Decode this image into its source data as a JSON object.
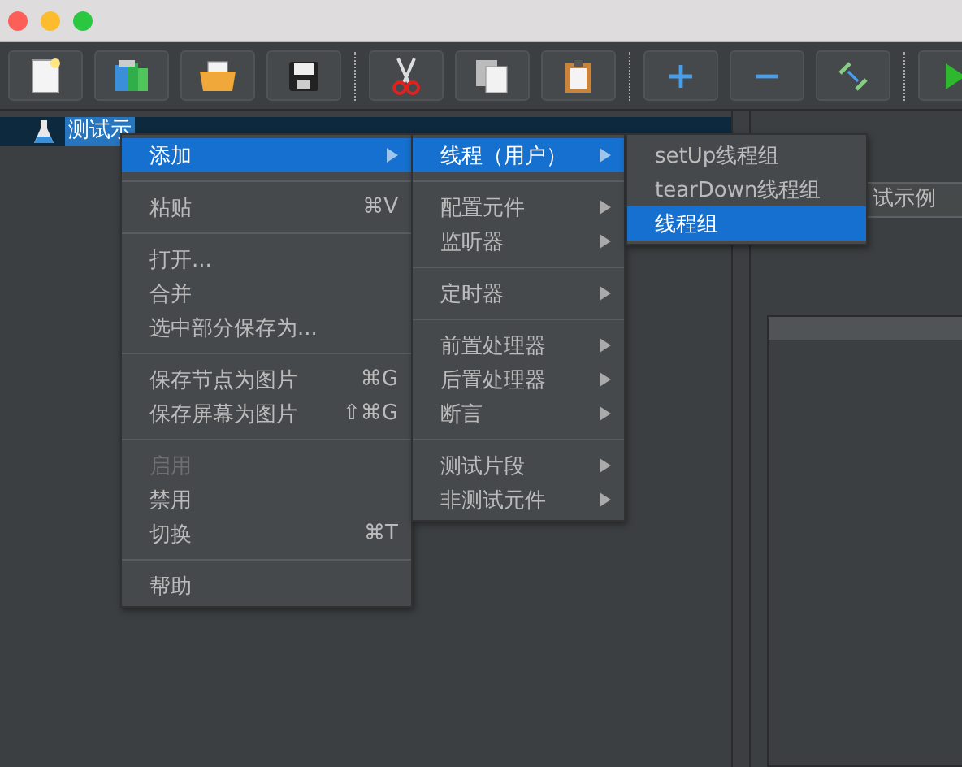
{
  "tree": {
    "items": [
      {
        "label": "测试示",
        "selected": true
      }
    ]
  },
  "name_field": {
    "value": "试示例"
  },
  "context_menu": {
    "items": [
      {
        "kind": "item",
        "label": "添加",
        "has_submenu": true,
        "selected": true,
        "disabled": false
      },
      {
        "kind": "separator"
      },
      {
        "kind": "item",
        "label": "粘贴",
        "shortcut": "⌘V",
        "has_submenu": false,
        "selected": false,
        "disabled": false
      },
      {
        "kind": "separator"
      },
      {
        "kind": "item",
        "label": "打开...",
        "has_submenu": false,
        "selected": false,
        "disabled": false
      },
      {
        "kind": "item",
        "label": "合并",
        "has_submenu": false,
        "selected": false,
        "disabled": false
      },
      {
        "kind": "item",
        "label": "选中部分保存为...",
        "has_submenu": false,
        "selected": false,
        "disabled": false
      },
      {
        "kind": "separator"
      },
      {
        "kind": "item",
        "label": "保存节点为图片",
        "shortcut": "⌘G",
        "has_submenu": false,
        "selected": false,
        "disabled": false
      },
      {
        "kind": "item",
        "label": "保存屏幕为图片",
        "shortcut": "⇧⌘G",
        "has_submenu": false,
        "selected": false,
        "disabled": false
      },
      {
        "kind": "separator"
      },
      {
        "kind": "item",
        "label": "启用",
        "has_submenu": false,
        "selected": false,
        "disabled": true
      },
      {
        "kind": "item",
        "label": "禁用",
        "has_submenu": false,
        "selected": false,
        "disabled": false
      },
      {
        "kind": "item",
        "label": "切换",
        "shortcut": "⌘T",
        "has_submenu": false,
        "selected": false,
        "disabled": false
      },
      {
        "kind": "separator"
      },
      {
        "kind": "item",
        "label": "帮助",
        "has_submenu": false,
        "selected": false,
        "disabled": false
      }
    ]
  },
  "add_submenu": {
    "items": [
      {
        "kind": "item",
        "label": "线程（用户）",
        "has_submenu": true,
        "selected": true,
        "disabled": false
      },
      {
        "kind": "separator"
      },
      {
        "kind": "item",
        "label": "配置元件",
        "has_submenu": true,
        "selected": false,
        "disabled": false
      },
      {
        "kind": "item",
        "label": "监听器",
        "has_submenu": true,
        "selected": false,
        "disabled": false
      },
      {
        "kind": "separator"
      },
      {
        "kind": "item",
        "label": "定时器",
        "has_submenu": true,
        "selected": false,
        "disabled": false
      },
      {
        "kind": "separator"
      },
      {
        "kind": "item",
        "label": "前置处理器",
        "has_submenu": true,
        "selected": false,
        "disabled": false
      },
      {
        "kind": "item",
        "label": "后置处理器",
        "has_submenu": true,
        "selected": false,
        "disabled": false
      },
      {
        "kind": "item",
        "label": "断言",
        "has_submenu": true,
        "selected": false,
        "disabled": false
      },
      {
        "kind": "separator"
      },
      {
        "kind": "item",
        "label": "测试片段",
        "has_submenu": true,
        "selected": false,
        "disabled": false
      },
      {
        "kind": "item",
        "label": "非测试元件",
        "has_submenu": true,
        "selected": false,
        "disabled": false
      }
    ]
  },
  "threads_submenu": {
    "items": [
      {
        "kind": "item",
        "label": "setUp线程组",
        "has_submenu": false,
        "selected": false,
        "disabled": false
      },
      {
        "kind": "item",
        "label": "tearDown线程组",
        "has_submenu": false,
        "selected": false,
        "disabled": false
      },
      {
        "kind": "item",
        "label": "线程组",
        "has_submenu": false,
        "selected": true,
        "disabled": false
      }
    ]
  }
}
